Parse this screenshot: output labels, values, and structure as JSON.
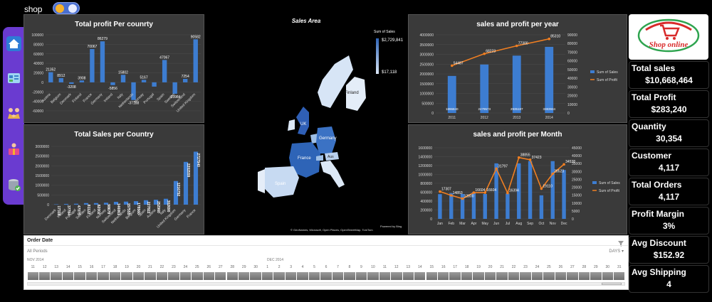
{
  "app": {
    "brand": "shop"
  },
  "charts": {
    "profit_country": {
      "title": "Total profit Per counrty",
      "chart_data": {
        "type": "bar",
        "categories": [
          "Austria",
          "Belgium",
          "Denmark",
          "Finland",
          "France",
          "Germany",
          "Ireland",
          "Italy",
          "Netherlands",
          "Norway",
          "Portugal",
          "Spain",
          "Sweden",
          "Switzerland",
          "United Kingdom"
        ],
        "values": [
          21352,
          8912,
          -3208,
          3908,
          70067,
          86279,
          -5856,
          15802,
          -37188,
          5167,
          -9000,
          47067,
          -23984,
          7254,
          90582
        ],
        "labels": [
          "21352",
          "8912",
          "-3208",
          "3908",
          "70067",
          "86279",
          "-5856",
          "15802",
          "-37188",
          "5167",
          "",
          "47067",
          "-23984",
          "7254",
          "90582"
        ],
        "yticks": [
          "100000",
          "80000",
          "60000",
          "40000",
          "20000",
          "0",
          "-20000",
          "-40000",
          "-60000"
        ],
        "ylim": [
          -60000,
          100000
        ]
      }
    },
    "sales_country": {
      "title": "Total Sales per Country",
      "chart_data": {
        "type": "bar",
        "categories": [
          "Denmark",
          "Ireland",
          "Portugal",
          "Sweden",
          "Finland",
          "Norway",
          "Switzerland",
          "Netherlands",
          "Belgium",
          "Spain",
          "Austria",
          "Italy",
          "United Kingdom",
          "Germany",
          "France"
        ],
        "values": [
          17318,
          37784,
          47075,
          81122,
          82002,
          98678,
          146061,
          157555,
          178560,
          227822,
          252960,
          302690,
          1216792,
          2202559,
          2727940
        ],
        "labels": [
          "17318",
          "37784",
          "47075",
          "81122",
          "82002",
          "98678",
          "146061",
          "157555",
          "178560",
          "227822",
          "252960",
          "302690",
          "1216792",
          "2202559",
          "2727940"
        ],
        "yticks": [
          "3000000",
          "2500000",
          "2000000",
          "1500000",
          "1000000",
          "500000",
          "0"
        ],
        "ylim": [
          0,
          3000000
        ]
      }
    },
    "map": {
      "title": "Sales Area",
      "legend_title": "Sum of Sales",
      "legend_max": "$2,729,841",
      "legend_min": "$17,118",
      "labels": [
        "Finland",
        "UK",
        "Germany",
        "France",
        "Spain",
        "Aus"
      ],
      "credit1": "Powered by Bing",
      "credit2": "© GeoNames, Microsoft, Open Places, OpenStreetMap, TomTom"
    },
    "sales_year": {
      "title": "sales and profit per year",
      "chart_data": {
        "type": "bar",
        "categories": [
          "2011",
          "2012",
          "2013",
          "2014"
        ],
        "series": [
          {
            "name": "Sum of Sales",
            "values": [
              1896840,
              2479573,
              2935187,
              3383934
            ]
          },
          {
            "name": "Sum of Profit",
            "values": [
              54487,
              68223,
              77300,
              85310
            ]
          }
        ],
        "left_ticks": [
          "4000000",
          "3500000",
          "3000000",
          "2500000",
          "2000000",
          "1500000",
          "1000000",
          "500000",
          "0"
        ],
        "right_ticks": [
          "90000",
          "80000",
          "70000",
          "60000",
          "50000",
          "40000",
          "30000",
          "20000",
          "10000",
          "0"
        ],
        "ylim_left": [
          0,
          4000000
        ],
        "ylim_right": [
          0,
          90000
        ]
      }
    },
    "sales_month": {
      "title": "sales and profit per Month",
      "chart_data": {
        "type": "bar",
        "categories": [
          "Jan",
          "Feb",
          "Mar",
          "Apr",
          "May",
          "Jun",
          "Jul",
          "Aug",
          "Sep",
          "Oct",
          "Nov",
          "Dec"
        ],
        "series": [
          {
            "name": "Sum of Sales",
            "values": [
              557000,
              580000,
              560000,
              600000,
              560000,
              1250000,
              570000,
              1250000,
              1300000,
              530000,
              1300000,
              1100000
            ]
          },
          {
            "name": "Sum of Profit",
            "values": [
              17307,
              14853,
              12800,
              16604,
              16604,
              31797,
              16394,
              38855,
              37423,
              19110,
              28523,
              34538
            ]
          }
        ],
        "profit_labels": [
          "17307",
          "14853",
          "12800",
          "16604",
          "16604",
          "31797",
          "16394",
          "38855",
          "37423",
          "19110",
          "28523",
          "34538"
        ],
        "left_ticks": [
          "1600000",
          "1400000",
          "1200000",
          "1000000",
          "800000",
          "600000",
          "400000",
          "200000",
          "0"
        ],
        "right_ticks": [
          "45000",
          "40000",
          "35000",
          "30000",
          "25000",
          "20000",
          "15000",
          "10000",
          "5000",
          "0"
        ],
        "ylim_left": [
          0,
          1600000
        ],
        "ylim_right": [
          0,
          45000
        ]
      }
    }
  },
  "slicer": {
    "title": "Order Date",
    "period": "All Periods",
    "unit": "DAYS",
    "month1": "NOV 2014",
    "month2": "DEC 2014",
    "days": [
      "11",
      "12",
      "13",
      "14",
      "15",
      "16",
      "17",
      "18",
      "19",
      "20",
      "21",
      "22",
      "23",
      "24",
      "25",
      "26",
      "27",
      "28",
      "29",
      "30",
      "1",
      "2",
      "3",
      "4",
      "5",
      "6",
      "7",
      "8",
      "9",
      "10",
      "11",
      "12",
      "13",
      "14",
      "15",
      "16",
      "17",
      "18",
      "19",
      "20",
      "21",
      "22",
      "23",
      "24",
      "25",
      "26",
      "27",
      "28",
      "29",
      "30",
      "31"
    ]
  },
  "logo": {
    "text": "Shop online"
  },
  "kpis": [
    {
      "label": "Total sales",
      "value": "$10,668,464"
    },
    {
      "label": "Total Profit",
      "value": "$283,240"
    },
    {
      "label": "Quantity",
      "value": "30,354"
    },
    {
      "label": "Customer",
      "value": "4,117"
    },
    {
      "label": "Total Orders",
      "value": "4,117"
    },
    {
      "label": "Profit Margin",
      "value": "3%"
    },
    {
      "label": "Avg Discount",
      "value": "$152.92"
    },
    {
      "label": "Avg Shipping",
      "value": "4"
    }
  ],
  "colors": {
    "bar": "#3d7dd1",
    "line": "#f07f22",
    "sidebar": "#6a3bd0"
  }
}
